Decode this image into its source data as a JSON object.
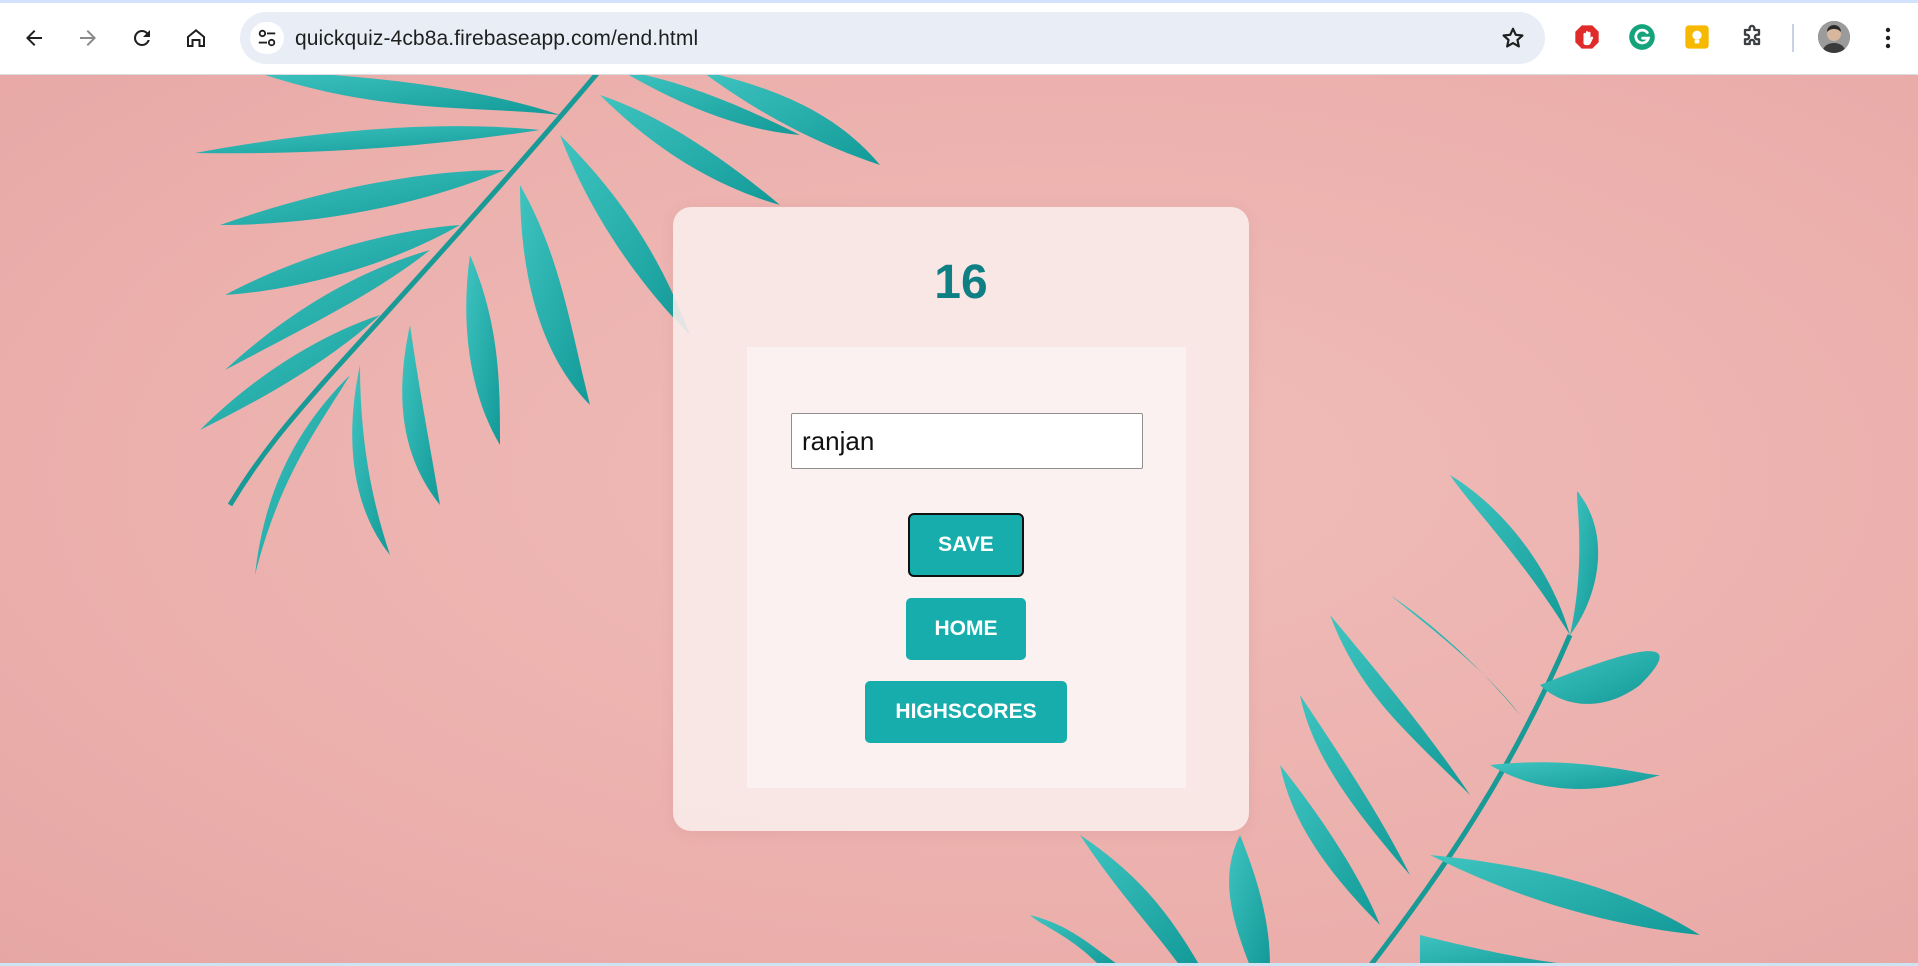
{
  "browser": {
    "url": "quickquiz-4cb8a.firebaseapp.com/end.html",
    "back_icon": "arrow-left-icon",
    "forward_icon": "arrow-right-icon",
    "reload_icon": "reload-icon",
    "home_icon": "home-icon",
    "site_info_icon": "tune-icon",
    "bookmark_icon": "star-icon",
    "extensions": [
      {
        "name": "adblock",
        "color": "#e02b2b"
      },
      {
        "name": "grammarly",
        "color": "#15a37c"
      },
      {
        "name": "keep",
        "color": "#f6b900"
      },
      {
        "name": "extensions-puzzle",
        "color": "#3c4043"
      }
    ],
    "menu_icon": "more-vertical-icon"
  },
  "page": {
    "score": "16",
    "username": {
      "value": "ranjan",
      "placeholder": ""
    },
    "buttons": {
      "save": "SAVE",
      "home": "HOME",
      "highscores": "HIGHSCORES"
    },
    "colors": {
      "accent": "#17adac",
      "score": "#0e7f83",
      "background": "#efb5b1"
    }
  }
}
